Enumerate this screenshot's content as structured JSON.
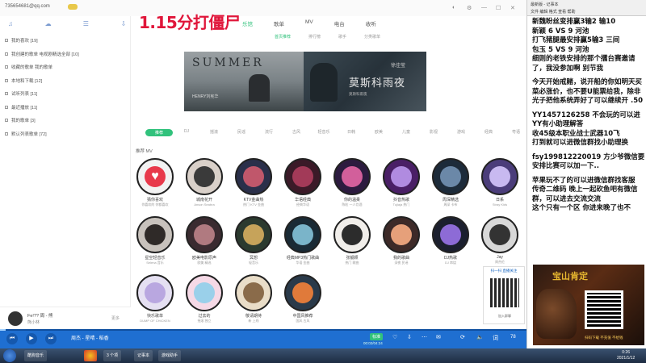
{
  "app": {
    "account": "735654681@qq.com",
    "overlay_title": "1.15分打僵尸"
  },
  "nav": {
    "main": [
      "乐馆",
      "歌单",
      "MV",
      "电台",
      "收听"
    ],
    "sub": [
      "首页推荐",
      "排行榜",
      "歌手",
      "分类歌单"
    ]
  },
  "sidebar": {
    "items": [
      "我的喜欢 [19]",
      "我创建的歌单 电视剧精选全部 [10]",
      "收藏的歌单 我的歌单",
      "本地和下载 [12]",
      "试听列表 [11]",
      "最近播放 [11]",
      "我的歌单 [3]",
      "默认列表歌单 [72]"
    ]
  },
  "banners": [
    {
      "title": "SUMMER",
      "subtitle": "HENRY刘宪华"
    },
    {
      "title": "莫斯科雨夜",
      "artist": "徐佳莹",
      "subtitle": "莫斯科雨夜"
    }
  ],
  "categories": [
    "推荐",
    "DJ",
    "摇滚",
    "民谣",
    "流行",
    "古风",
    "轻音乐",
    "日韩",
    "欧美",
    "儿童",
    "影视",
    "游戏",
    "经典",
    "粤语",
    "广场"
  ],
  "section_title": "推荐 MV",
  "tiles": [
    {
      "name": "猜你喜欢",
      "desc": "你喜欢的 你都喜欢"
    },
    {
      "name": "城南花开",
      "desc": "Anson Seabra"
    },
    {
      "name": "KTV金曲热",
      "desc": "热门 KTV 金曲"
    },
    {
      "name": "华语经典",
      "desc": "经典华语"
    },
    {
      "name": "你的温柔",
      "desc": "陈粒 一人饮酒"
    },
    {
      "name": "抖音热歌",
      "desc": "Tujiaja 热门"
    },
    {
      "name": "周深精选",
      "desc": "周深 卡布"
    },
    {
      "name": "日系",
      "desc": "Stray Kids"
    },
    {
      "name": "星空轻音乐",
      "desc": "Selena 音乐"
    },
    {
      "name": "欧美电影原声",
      "desc": "欧美 精选"
    },
    {
      "name": "冥想",
      "desc": "轻音乐"
    },
    {
      "name": "经典MP3热门歌曲",
      "desc": "华语 金曲"
    },
    {
      "name": "张靓颖",
      "desc": "热门 歌曲"
    },
    {
      "name": "我的歌曲",
      "desc": "深夜 民谣"
    },
    {
      "name": "DJ热歌",
      "desc": "DJ 串烧"
    },
    {
      "name": "Jay",
      "desc": "周杰伦"
    },
    {
      "name": "快乐歌单",
      "desc": "DUMP OF CHICKEN"
    },
    {
      "name": "过去的",
      "desc": "摇滚 独立"
    },
    {
      "name": "敬请期待",
      "desc": "新 上线"
    },
    {
      "name": "中国风推荐",
      "desc": "国风 古风"
    }
  ],
  "player": {
    "track": "Fe!?? 周 - 熊",
    "artist": "熊小林",
    "more": "更多",
    "song_bar": "周杰 - 星晴 - 稻香",
    "quality": "标准",
    "time": "00:02/04:24",
    "count": "78"
  },
  "notepad": {
    "title": "最新版 - 记事本",
    "menu": "文件 编辑 格式 查看 帮助",
    "lines": [
      "新魏盼丝变排赢3输2 输10",
      "新颖 6 VS 9 河池",
      "打飞猪腿最安排赢5输3 三间",
      "包玉 5 VS 9 河池",
      "细则的老铁安排的那个擂台赛邀请了，我没参加啊 别节我",
      "",
      "今天开始戒赌，说开船的你如明天买菜必涨价，也不要U能票给我，除非光子把他系统弄好了可以继续开 .50",
      "",
      "YY1457126258 不会玩的可以进YY有小助理解答",
      "收45级本职业战士武器10飞",
      "打到就可以进微信群找小助理换",
      "",
      "fsy199812220019 方少爷微信要安排比赛可以加一下..",
      "",
      "苹果玩不了的可以进微信群找客服",
      "传奇二维码 晚上一起砍鱼吧有微信群，可以进去交流交流",
      "这个只有一个区 你进来晚了也不"
    ],
    "qr_caption": "扫一扫 直播关注",
    "qr_caption2": "加入群聊",
    "ad_title": "宝山肯定",
    "ad_caption": "扫码下载 不充值 不给钱"
  },
  "taskbar": {
    "items": [
      "酷狗音乐",
      "3 个项",
      "记事本",
      "游戏助手"
    ],
    "time": "0:26",
    "date": "2021/1/12"
  },
  "colors": {
    "accent": "#31c27c",
    "overlay": "#e0163a",
    "bottombar": "#1f6fd1"
  }
}
